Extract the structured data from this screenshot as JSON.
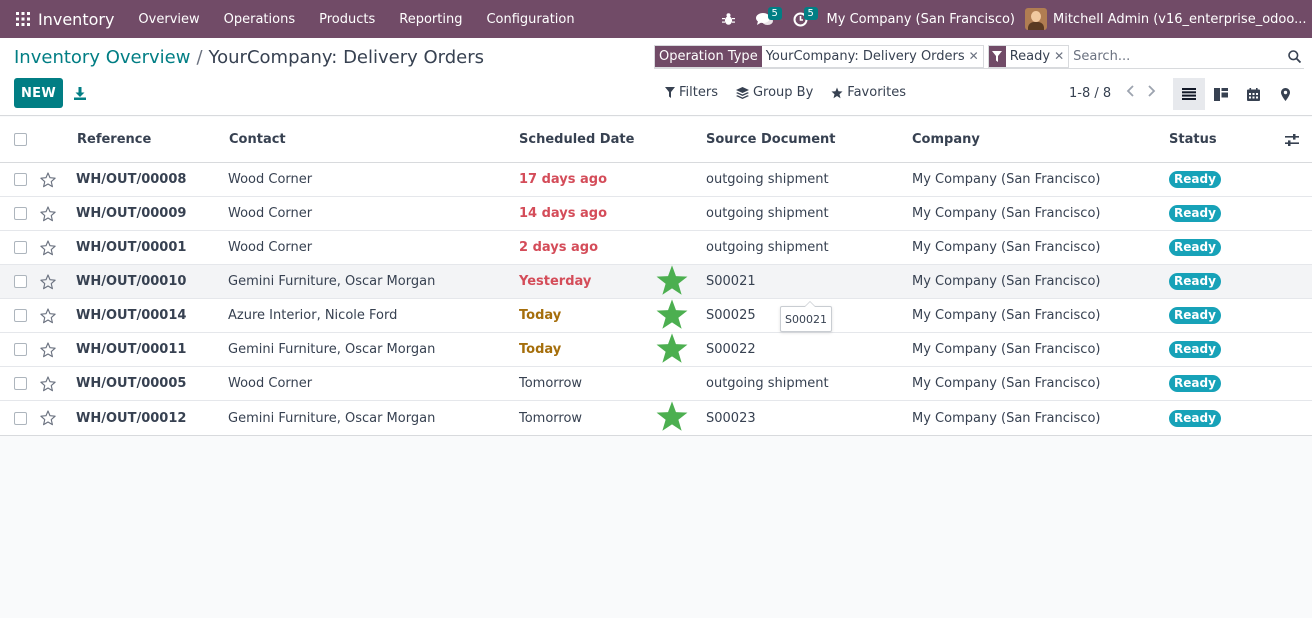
{
  "navbar": {
    "app_name": "Inventory",
    "menu": [
      "Overview",
      "Operations",
      "Products",
      "Reporting",
      "Configuration"
    ],
    "messages_count": "5",
    "activities_count": "5",
    "company": "My Company (San Francisco)",
    "user": "Mitchell Admin (v16_enterprise_odoo..."
  },
  "breadcrumb": {
    "parent": "Inventory Overview",
    "separator": "/",
    "current": "YourCompany: Delivery Orders"
  },
  "toolbar": {
    "new_label": "NEW"
  },
  "search": {
    "facets": [
      {
        "label": "Operation Type",
        "value": "YourCompany: Delivery Orders"
      },
      {
        "value": "Ready"
      }
    ],
    "placeholder": "Search..."
  },
  "filters": {
    "filters_label": "Filters",
    "groupby_label": "Group By",
    "favorites_label": "Favorites"
  },
  "pager": {
    "text": "1-8 / 8"
  },
  "table": {
    "headers": {
      "reference": "Reference",
      "contact": "Contact",
      "scheduled_date": "Scheduled Date",
      "source_document": "Source Document",
      "company": "Company",
      "status": "Status"
    },
    "rows": [
      {
        "reference": "WH/OUT/00008",
        "contact": "Wood Corner",
        "scheduled_date": "17 days ago",
        "date_style": "red",
        "source_document": "outgoing shipment",
        "company": "My Company (San Francisco)",
        "status": "Ready",
        "marker": false
      },
      {
        "reference": "WH/OUT/00009",
        "contact": "Wood Corner",
        "scheduled_date": "14 days ago",
        "date_style": "red",
        "source_document": "outgoing shipment",
        "company": "My Company (San Francisco)",
        "status": "Ready",
        "marker": false
      },
      {
        "reference": "WH/OUT/00001",
        "contact": "Wood Corner",
        "scheduled_date": "2 days ago",
        "date_style": "red",
        "source_document": "outgoing shipment",
        "company": "My Company (San Francisco)",
        "status": "Ready",
        "marker": false
      },
      {
        "reference": "WH/OUT/00010",
        "contact": "Gemini Furniture, Oscar Morgan",
        "scheduled_date": "Yesterday",
        "date_style": "red",
        "source_document": "S00021",
        "company": "My Company (San Francisco)",
        "status": "Ready",
        "marker": true
      },
      {
        "reference": "WH/OUT/00014",
        "contact": "Azure Interior, Nicole Ford",
        "scheduled_date": "Today",
        "date_style": "amber",
        "source_document": "S00025",
        "company": "My Company (San Francisco)",
        "status": "Ready",
        "marker": true
      },
      {
        "reference": "WH/OUT/00011",
        "contact": "Gemini Furniture, Oscar Morgan",
        "scheduled_date": "Today",
        "date_style": "amber",
        "source_document": "S00022",
        "company": "My Company (San Francisco)",
        "status": "Ready",
        "marker": true
      },
      {
        "reference": "WH/OUT/00005",
        "contact": "Wood Corner",
        "scheduled_date": "Tomorrow",
        "date_style": "normal",
        "source_document": "outgoing shipment",
        "company": "My Company (San Francisco)",
        "status": "Ready",
        "marker": false
      },
      {
        "reference": "WH/OUT/00012",
        "contact": "Gemini Furniture, Oscar Morgan",
        "scheduled_date": "Tomorrow",
        "date_style": "normal",
        "source_document": "S00023",
        "company": "My Company (San Francisco)",
        "status": "Ready",
        "marker": true
      }
    ],
    "hover_row_index": 3
  },
  "tooltip": {
    "text": "S00021"
  },
  "colors": {
    "brand": "#714b67",
    "accent": "#017e84",
    "late": "#d44c59",
    "today": "#a56e0b",
    "ready_badge": "#17a2b8",
    "marker_star": "#4caf50"
  },
  "icons": {
    "apps": "grid-icon",
    "debug": "bug-icon",
    "messages": "chat-icon",
    "activities": "clock-icon",
    "download": "download-icon",
    "search": "search-icon",
    "filters": "filter-icon",
    "groupby": "layers-icon",
    "favorites": "star-icon",
    "pager_prev": "chevron-left-icon",
    "pager_next": "chevron-right-icon",
    "list_view": "list-icon",
    "kanban_view": "kanban-icon",
    "calendar_view": "calendar-icon",
    "map_view": "map-marker-icon",
    "optional_columns": "sliders-icon"
  }
}
